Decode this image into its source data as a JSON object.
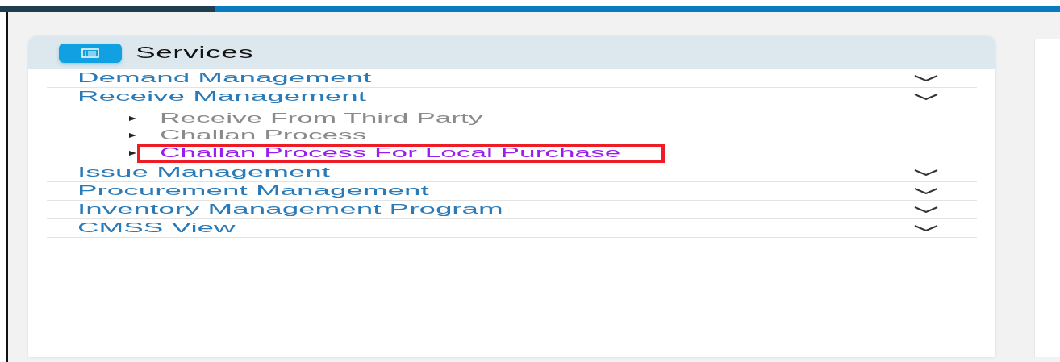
{
  "services": {
    "title": "Services",
    "items": [
      {
        "label": "Demand Management"
      },
      {
        "label": "Receive Management",
        "children": [
          {
            "label": "Receive From Third Party",
            "selected": false
          },
          {
            "label": "Challan Process",
            "selected": false
          },
          {
            "label": "Challan Process For Local Purchase",
            "selected": true
          }
        ]
      },
      {
        "label": "Issue Management"
      },
      {
        "label": "Procurement Management"
      },
      {
        "label": "Inventory Management Program"
      },
      {
        "label": "CMSS View"
      }
    ]
  }
}
